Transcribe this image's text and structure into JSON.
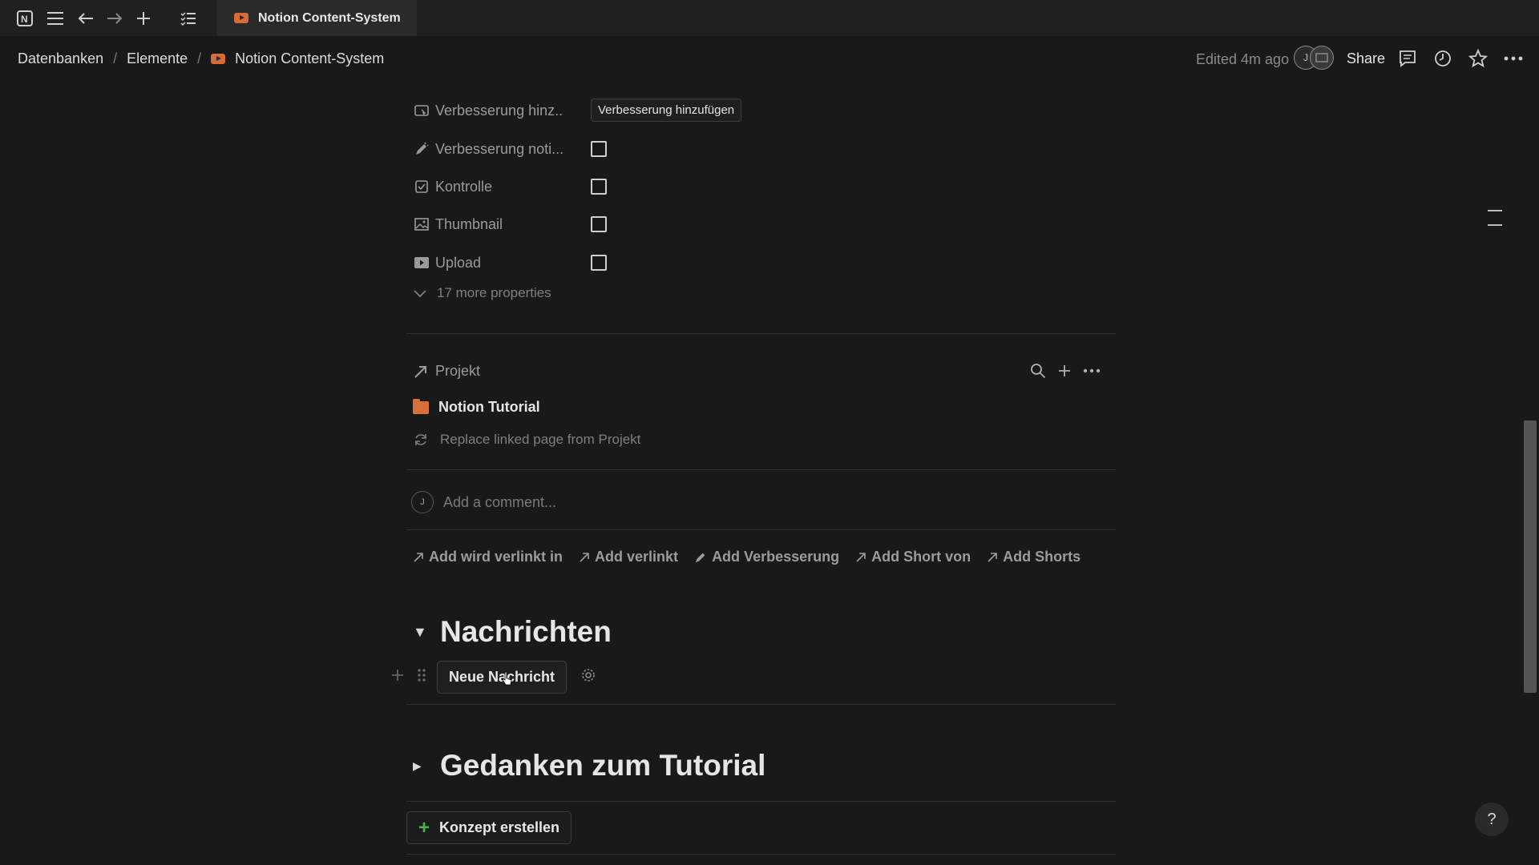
{
  "titlebar": {
    "tab_title": "Notion Content-System"
  },
  "breadcrumb": {
    "items": [
      "Datenbanken",
      "Elemente",
      "Notion Content-System"
    ],
    "separator": "/"
  },
  "topbar": {
    "edited": "Edited 4m ago",
    "avatar_initial": "J",
    "share_label": "Share"
  },
  "properties": [
    {
      "icon": "button-icon",
      "name": "Verbesserung hinz...",
      "type": "button",
      "value": "Verbesserung hinzufügen"
    },
    {
      "icon": "pen-icon",
      "name": "Verbesserung noti...",
      "type": "checkbox",
      "checked": false
    },
    {
      "icon": "checkbox-icon",
      "name": "Kontrolle",
      "type": "checkbox",
      "checked": false
    },
    {
      "icon": "image-icon",
      "name": "Thumbnail",
      "type": "checkbox",
      "checked": false
    },
    {
      "icon": "video-icon",
      "name": "Upload",
      "type": "checkbox",
      "checked": false
    }
  ],
  "more_properties": "17 more properties",
  "relation": {
    "title": "Projekt",
    "item": "Notion Tutorial",
    "replace": "Replace linked page from Projekt"
  },
  "comment": {
    "avatar_initial": "J",
    "placeholder": "Add a comment..."
  },
  "add_links": [
    "Add wird verlinkt in",
    "Add verlinkt",
    "Add Verbesserung",
    "Add Short von",
    "Add Shorts"
  ],
  "sections": {
    "nachrichten": {
      "title": "Nachrichten",
      "button": "Neue Nachricht"
    },
    "gedanken": {
      "title": "Gedanken zum Tutorial",
      "button": "Konzept erstellen"
    }
  },
  "help_label": "?",
  "colors": {
    "background": "#191919",
    "accent_orange": "#d9703a",
    "accent_green": "#4caf50"
  }
}
